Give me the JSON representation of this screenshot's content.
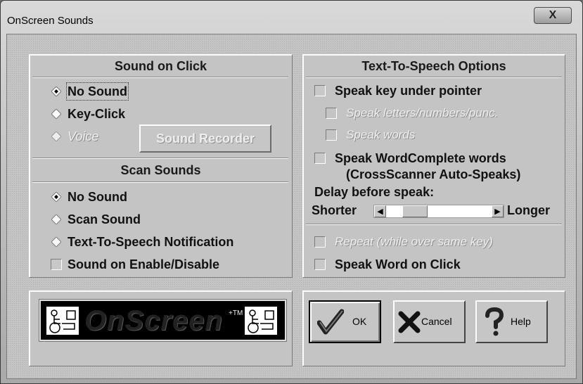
{
  "window": {
    "title": "OnScreen Sounds",
    "close_glyph": "X"
  },
  "sound_on_click": {
    "header": "Sound on Click",
    "options": [
      {
        "label": "No Sound",
        "selected": true,
        "enabled": true
      },
      {
        "label": "Key-Click",
        "selected": false,
        "enabled": true
      },
      {
        "label": "Voice",
        "selected": false,
        "enabled": false
      }
    ],
    "recorder_button": "Sound Recorder"
  },
  "scan_sounds": {
    "header": "Scan Sounds",
    "options": [
      {
        "label": "No Sound",
        "selected": true
      },
      {
        "label": "Scan Sound",
        "selected": false
      },
      {
        "label": "Text-To-Speech Notification",
        "selected": false
      }
    ],
    "enable_checkbox": "Sound on Enable/Disable"
  },
  "tts": {
    "header": "Text-To-Speech Options",
    "speak_key": "Speak key under pointer",
    "speak_letters": "Speak letters/numbers/punc.",
    "speak_words": "Speak words",
    "wordcomplete_line1": "Speak WordComplete words",
    "wordcomplete_line2": "(CrossScanner Auto-Speaks)",
    "delay_label": "Delay before speak:",
    "shorter": "Shorter",
    "longer": "Longer",
    "delay_level": 0.2,
    "repeat": "Repeat (while over same key)",
    "speak_word_click": "Speak Word on Click"
  },
  "logo": {
    "text": "OnScreen",
    "tm": "+TM"
  },
  "buttons": {
    "ok": "OK",
    "cancel": "Cancel",
    "help": "Help"
  },
  "colors": {
    "background": "#c4c4c4",
    "logo_bg": "#000000"
  }
}
